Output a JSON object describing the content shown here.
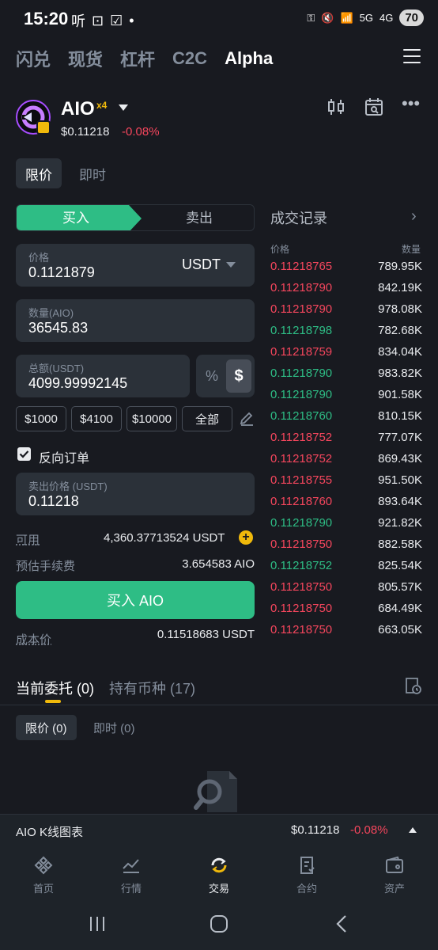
{
  "status": {
    "time": "15:20",
    "battery": "70"
  },
  "nav": {
    "tabs": [
      "闪兑",
      "现货",
      "杠杆",
      "C2C",
      "Alpha"
    ],
    "active": "Alpha"
  },
  "token": {
    "name": "AIO",
    "multiplier": "x4",
    "price": "$0.11218",
    "change": "-0.08%"
  },
  "order_types": {
    "limit": "限价",
    "market": "即时"
  },
  "side": {
    "buy": "买入",
    "sell": "卖出"
  },
  "form": {
    "price_label": "价格",
    "price_value": "0.1121879",
    "price_unit": "USDT",
    "qty_label": "数量(AIO)",
    "qty_value": "36545.83",
    "total_label": "总额(USDT)",
    "total_value": "4099.99992145",
    "pct_symbol": "%",
    "usd_symbol": "$",
    "chips": [
      "$1000",
      "$4100",
      "$10000",
      "全部"
    ],
    "reverse_label": "反向订单",
    "sell_price_label": "卖出价格 (USDT)",
    "sell_price_value": "0.11218",
    "available_label": "可用",
    "available_value": "4,360.37713524 USDT",
    "fee_label": "预估手续费",
    "fee_value": "3.654583 AIO",
    "buy_button": "买入 AIO",
    "cost_label": "成本价",
    "cost_value": "0.11518683 USDT"
  },
  "trades": {
    "title": "成交记录",
    "col_price": "价格",
    "col_qty": "数量",
    "rows": [
      {
        "price": "0.11218765",
        "qty": "789.95K",
        "side": "sell"
      },
      {
        "price": "0.11218790",
        "qty": "842.19K",
        "side": "sell"
      },
      {
        "price": "0.11218790",
        "qty": "978.08K",
        "side": "sell"
      },
      {
        "price": "0.11218798",
        "qty": "782.68K",
        "side": "buy"
      },
      {
        "price": "0.11218759",
        "qty": "834.04K",
        "side": "sell"
      },
      {
        "price": "0.11218790",
        "qty": "983.82K",
        "side": "buy"
      },
      {
        "price": "0.11218790",
        "qty": "901.58K",
        "side": "buy"
      },
      {
        "price": "0.11218760",
        "qty": "810.15K",
        "side": "buy"
      },
      {
        "price": "0.11218752",
        "qty": "777.07K",
        "side": "sell"
      },
      {
        "price": "0.11218752",
        "qty": "869.43K",
        "side": "sell"
      },
      {
        "price": "0.11218755",
        "qty": "951.50K",
        "side": "sell"
      },
      {
        "price": "0.11218760",
        "qty": "893.64K",
        "side": "sell"
      },
      {
        "price": "0.11218790",
        "qty": "921.82K",
        "side": "buy"
      },
      {
        "price": "0.11218750",
        "qty": "882.58K",
        "side": "sell"
      },
      {
        "price": "0.11218752",
        "qty": "825.54K",
        "side": "buy"
      },
      {
        "price": "0.11218750",
        "qty": "805.57K",
        "side": "sell"
      },
      {
        "price": "0.11218750",
        "qty": "684.49K",
        "side": "sell"
      },
      {
        "price": "0.11218750",
        "qty": "663.05K",
        "side": "sell"
      }
    ]
  },
  "orders": {
    "tab_open": "当前委托 (0)",
    "tab_holdings": "持有币种 (17)",
    "sub_limit": "限价 (0)",
    "sub_market": "即时 (0)"
  },
  "kline": {
    "label": "AIO K线图表",
    "price": "$0.11218",
    "change": "-0.08%"
  },
  "bottom_nav": [
    "首页",
    "行情",
    "交易",
    "合约",
    "资产"
  ],
  "colors": {
    "buy": "#2ebd85",
    "sell": "#f6465d",
    "accent": "#f0b90b"
  }
}
